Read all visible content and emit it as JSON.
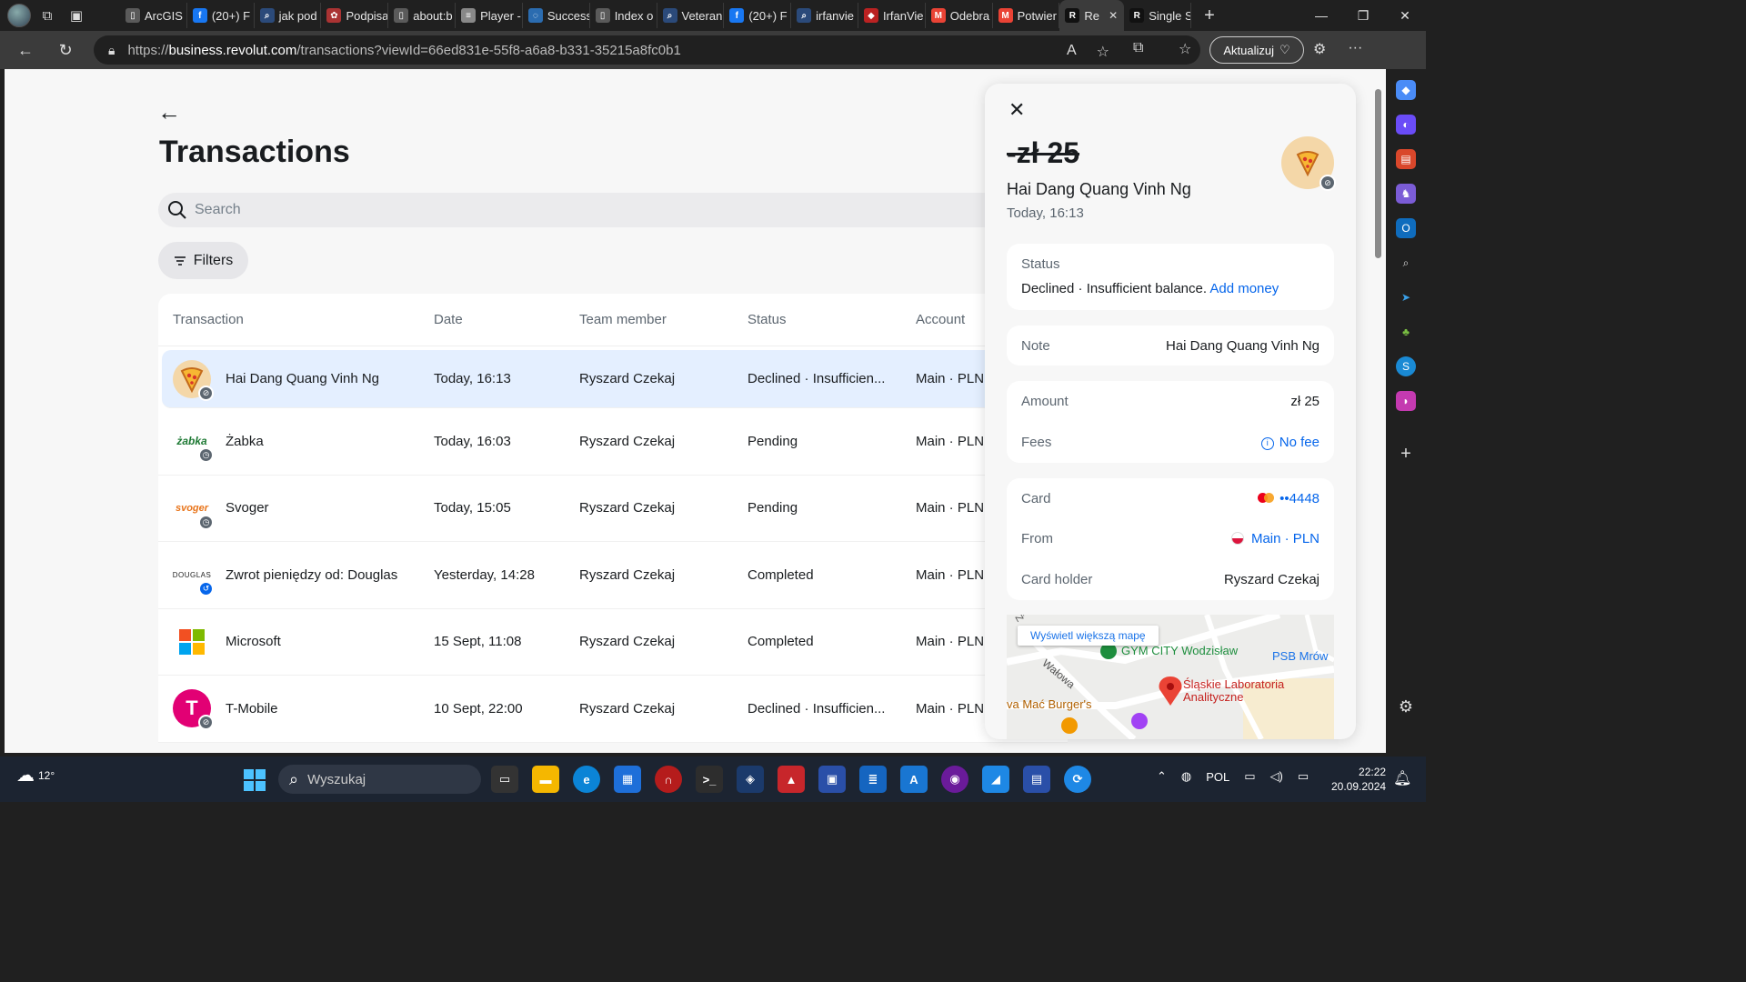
{
  "browser": {
    "tabs": [
      {
        "label": "ArcGIS",
        "color": "#5a5a5a",
        "glyph": "▯"
      },
      {
        "label": "(20+) F",
        "color": "#1877f2",
        "glyph": "f"
      },
      {
        "label": "jak pod",
        "color": "#2b4a7a",
        "glyph": "⌕"
      },
      {
        "label": "Podpisa",
        "color": "#a33",
        "glyph": "✿"
      },
      {
        "label": "about:b",
        "color": "#5a5a5a",
        "glyph": "▯"
      },
      {
        "label": "Player -",
        "color": "#888",
        "glyph": "≡"
      },
      {
        "label": "Success",
        "color": "#2b6cb0",
        "glyph": "◌"
      },
      {
        "label": "Index o",
        "color": "#5a5a5a",
        "glyph": "▯"
      },
      {
        "label": "Veteran",
        "color": "#2b4a7a",
        "glyph": "⌕"
      },
      {
        "label": "(20+) F",
        "color": "#1877f2",
        "glyph": "f"
      },
      {
        "label": "irfanvie",
        "color": "#2b4a7a",
        "glyph": "⌕"
      },
      {
        "label": "IrfanVie",
        "color": "#b22",
        "glyph": "◆"
      },
      {
        "label": "Odebra",
        "color": "#ea4335",
        "glyph": "M"
      },
      {
        "label": "Potwier",
        "color": "#ea4335",
        "glyph": "M"
      },
      {
        "label": "Re",
        "color": "#111",
        "glyph": "R",
        "active": true
      },
      {
        "label": "Single S",
        "color": "#111",
        "glyph": "R"
      }
    ],
    "url_prefix": "https://",
    "url_host": "business.revolut.com",
    "url_path": "/transactions?viewId=66ed831e-55f8-a6a8-b331-35215a8fc0b1",
    "update_label": "Aktualizuj"
  },
  "page": {
    "title": "Transactions",
    "search_placeholder": "Search",
    "filters_label": "Filters",
    "columns": [
      "Transaction",
      "Date",
      "Team member",
      "Status",
      "Account"
    ],
    "rows": [
      {
        "name": "Hai Dang Quang Vinh Ng",
        "date": "Today, 16:13",
        "member": "Ryszard Czekaj",
        "status": "Declined · Insufficien...",
        "account": "Main · PLN",
        "logo": "pizza",
        "badge": "⊘",
        "selected": true
      },
      {
        "name": "Żabka",
        "date": "Today, 16:03",
        "member": "Ryszard Czekaj",
        "status": "Pending",
        "account": "Main · PLN",
        "logo": "zabka",
        "badge": "◷"
      },
      {
        "name": "Svoger",
        "date": "Today, 15:05",
        "member": "Ryszard Czekaj",
        "status": "Pending",
        "account": "Main · PLN",
        "logo": "svoger",
        "badge": "◷"
      },
      {
        "name": "Zwrot pieniędzy od: Douglas",
        "date": "Yesterday, 14:28",
        "member": "Ryszard Czekaj",
        "status": "Completed",
        "account": "Main · PLN",
        "logo": "douglas",
        "badge": "↺"
      },
      {
        "name": "Microsoft",
        "date": "15 Sept, 11:08",
        "member": "Ryszard Czekaj",
        "status": "Completed",
        "account": "Main · PLN",
        "logo": "microsoft",
        "badge": ""
      },
      {
        "name": "T-Mobile",
        "date": "10 Sept, 22:00",
        "member": "Ryszard Czekaj",
        "status": "Declined · Insufficien...",
        "account": "Main · PLN",
        "logo": "tmobile",
        "badge": "⊘"
      }
    ],
    "logo_text": {
      "zabka": "żabka",
      "svoger": "svoger",
      "douglas": "DOUGLAS",
      "tmobile": "T"
    }
  },
  "detail": {
    "close_glyph": "✕",
    "amount": "-zł 25",
    "merchant": "Hai Dang Quang Vinh Ng",
    "time": "Today, 16:13",
    "status_label": "Status",
    "status_value": "Declined · Insufficient balance.",
    "add_money": "Add money",
    "note_label": "Note",
    "note_value": "Hai Dang Quang Vinh Ng",
    "amount_label": "Amount",
    "amount_value": "zł 25",
    "fees_label": "Fees",
    "fees_value": "No fee",
    "card_label": "Card",
    "card_value": "••4448",
    "from_label": "From",
    "from_value": "Main · PLN",
    "holder_label": "Card holder",
    "holder_value": "Ryszard Czekaj",
    "map": {
      "button": "Wyświetl większą mapę",
      "gym": "GYM CITY Wodzisław",
      "psb": "PSB Mrów",
      "lab": "Śląskie Laboratoria Analityczne",
      "street": "Wałowa",
      "burger": "va Mać Burger's",
      "street_cut": "Ż"
    }
  },
  "taskbar": {
    "temp": "12°",
    "search_placeholder": "Wyszukaj",
    "lang": "POL",
    "time": "22:22",
    "date": "20.09.2024"
  }
}
